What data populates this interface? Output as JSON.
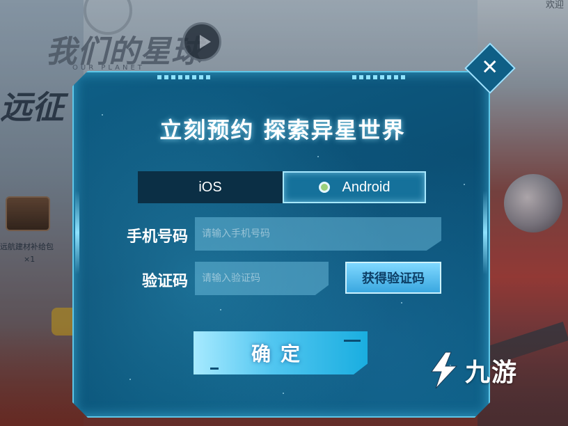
{
  "background": {
    "game_logo": "我们的星球",
    "game_logo_sub": "OUR PLANET",
    "welcome_text": "欢迎",
    "far_title": "远征",
    "crate_caption": "远航建材补给包",
    "crate_count": "×1"
  },
  "modal": {
    "title": "立刻预约 探索异星世界",
    "tabs": [
      {
        "label": "iOS",
        "selected": false
      },
      {
        "label": "Android",
        "selected": true
      }
    ],
    "phone": {
      "label": "手机号码",
      "placeholder": "请输入手机号码",
      "value": ""
    },
    "code": {
      "label": "验证码",
      "placeholder": "请输入验证码",
      "value": ""
    },
    "get_code_label": "获得验证码",
    "confirm_label": "确定",
    "close_glyph": "✕"
  },
  "watermark": {
    "text": "九游",
    "icon": "jiuyou-logo"
  },
  "colors": {
    "accent": "#5fc7e8",
    "panel": "#0f5f86",
    "selected_dot": "#9bd07b"
  }
}
